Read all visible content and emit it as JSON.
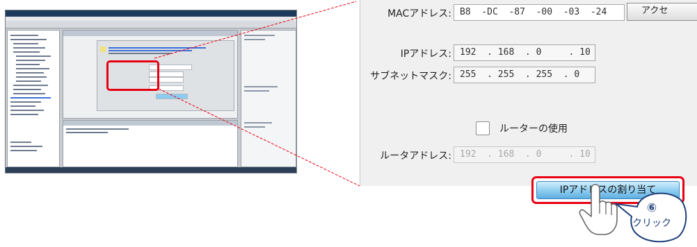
{
  "fields": {
    "mac": {
      "label": "MACアドレス:",
      "value": "B8  -DC  -87  -00  -03  -24"
    },
    "ip": {
      "label": "IPアドレス:",
      "value": "192  . 168  . 0     . 10"
    },
    "subnet": {
      "label": "サブネットマスク:",
      "value": "255  . 255  . 255  . 0"
    },
    "router": {
      "label": "ルータアドレス:",
      "value": "192  . 168  . 0     . 10"
    }
  },
  "access_button": {
    "label": "アクセ"
  },
  "router_checkbox": {
    "label": "ルーターの使用",
    "checked": false
  },
  "assign_button": {
    "label": "IPアドレスの割り当て"
  },
  "callout": {
    "step": "⑥",
    "text": "クリック"
  },
  "colors": {
    "highlight": "#e60012",
    "callout_border": "#1d3f7a",
    "button": "#8cccf0"
  },
  "icons": {
    "hand": "hand-pointer-icon"
  }
}
